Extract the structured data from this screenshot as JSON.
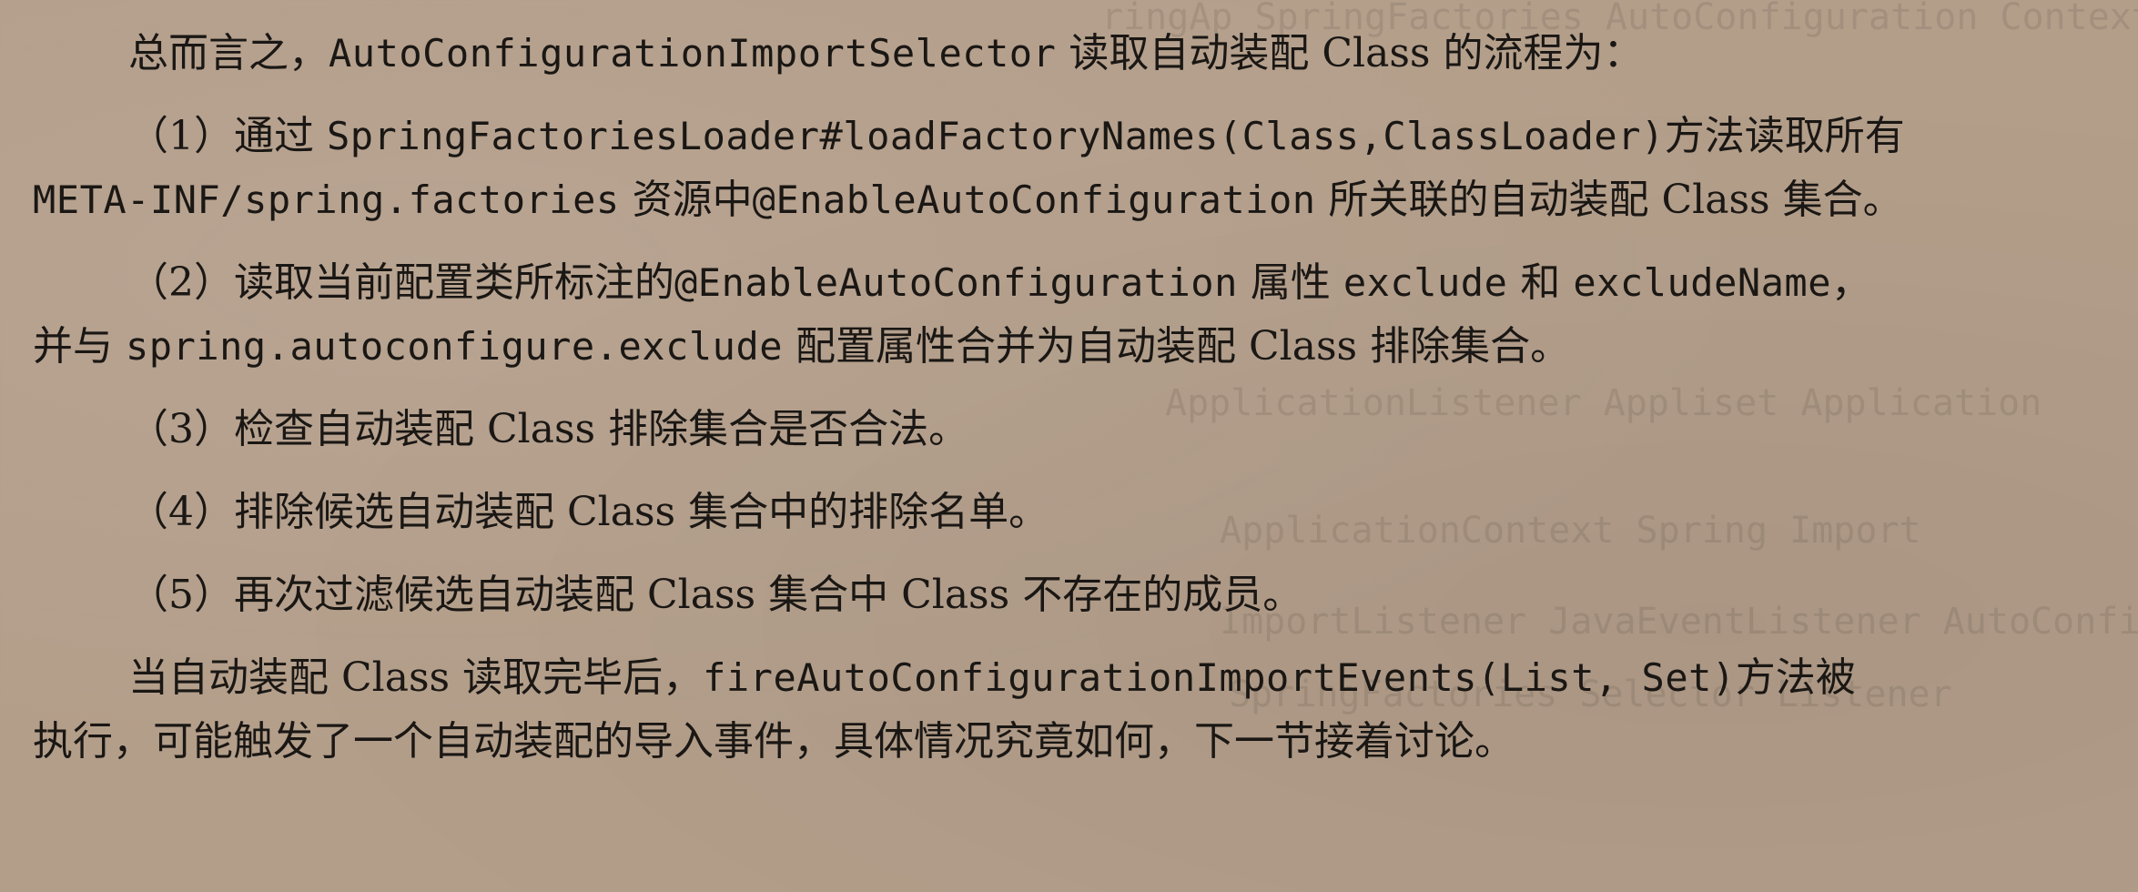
{
  "paragraphs": {
    "summary": {
      "t1": "总而言之，",
      "c1": "AutoConfigurationImportSelector",
      "t2": " 读取自动装配 Class 的流程为："
    },
    "step1": {
      "t1": "（1）通过 ",
      "c1": "SpringFactoriesLoader#loadFactoryNames(Class,ClassLoader)",
      "t2": "方法读取所有",
      "c2": "META-INF/spring.factories",
      "t3": " 资源中",
      "c3": "@EnableAutoConfiguration",
      "t4": " 所关联的自动装配 Class 集合。"
    },
    "step2": {
      "t1": "（2）读取当前配置类所标注的",
      "c1": "@EnableAutoConfiguration",
      "t2": " 属性 ",
      "c2": "exclude",
      "t3": " 和 ",
      "c3": "excludeName",
      "t4": "，",
      "t5": "并与 ",
      "c4": "spring.autoconfigure.exclude",
      "t6": " 配置属性合并为自动装配 Class 排除集合。"
    },
    "step3": {
      "t1": "（3）检查自动装配 Class 排除集合是否合法。"
    },
    "step4": {
      "t1": "（4）排除候选自动装配 Class 集合中的排除名单。"
    },
    "step5": {
      "t1": "（5）再次过滤候选自动装配 Class 集合中 Class 不存在的成员。"
    },
    "conclusion": {
      "t1": "当自动装配 Class 读取完毕后，",
      "c1": "fireAutoConfigurationImportEvents(List, Set)",
      "t2": "方法被",
      "t3": "执行，可能触发了一个自动装配的导入事件，具体情况究竟如何，下一节接着讨论。"
    }
  }
}
